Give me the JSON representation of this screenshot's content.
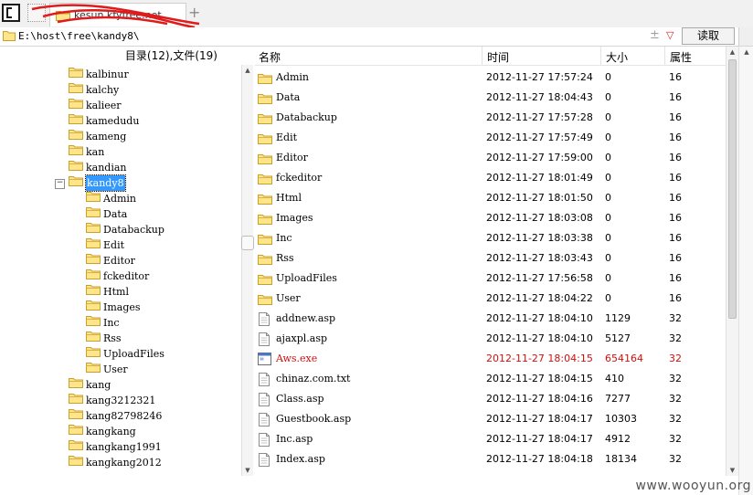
{
  "tab": {
    "title": "kesun.kfyfree.net"
  },
  "address": {
    "path": "E:\\host\\free\\kandy8\\",
    "plus": "±",
    "read_button": "读取"
  },
  "tree": {
    "header": "目录(12),文件(19)",
    "expander": "−",
    "items": [
      {
        "label": "kalbinur"
      },
      {
        "label": "kalchy"
      },
      {
        "label": "kalieer"
      },
      {
        "label": "kamedudu"
      },
      {
        "label": "kameng"
      },
      {
        "label": "kan"
      },
      {
        "label": "kandian"
      },
      {
        "label": "kandy8"
      },
      {
        "label": "Admin"
      },
      {
        "label": "Data"
      },
      {
        "label": "Databackup"
      },
      {
        "label": "Edit"
      },
      {
        "label": "Editor"
      },
      {
        "label": "fckeditor"
      },
      {
        "label": "Html"
      },
      {
        "label": "Images"
      },
      {
        "label": "Inc"
      },
      {
        "label": "Rss"
      },
      {
        "label": "UploadFiles"
      },
      {
        "label": "User"
      },
      {
        "label": "kang"
      },
      {
        "label": "kang3212321"
      },
      {
        "label": "kang82798246"
      },
      {
        "label": "kangkang"
      },
      {
        "label": "kangkang1991"
      },
      {
        "label": "kangkang2012"
      }
    ]
  },
  "list": {
    "columns": {
      "name": "名称",
      "time": "时间",
      "size": "大小",
      "attr": "属性"
    },
    "rows": [
      {
        "name": "Admin",
        "time": "2012-11-27 17:57:24",
        "size": "0",
        "attr": "16",
        "kind": "folder"
      },
      {
        "name": "Data",
        "time": "2012-11-27 18:04:43",
        "size": "0",
        "attr": "16",
        "kind": "folder"
      },
      {
        "name": "Databackup",
        "time": "2012-11-27 17:57:28",
        "size": "0",
        "attr": "16",
        "kind": "folder"
      },
      {
        "name": "Edit",
        "time": "2012-11-27 17:57:49",
        "size": "0",
        "attr": "16",
        "kind": "folder"
      },
      {
        "name": "Editor",
        "time": "2012-11-27 17:59:00",
        "size": "0",
        "attr": "16",
        "kind": "folder"
      },
      {
        "name": "fckeditor",
        "time": "2012-11-27 18:01:49",
        "size": "0",
        "attr": "16",
        "kind": "folder"
      },
      {
        "name": "Html",
        "time": "2012-11-27 18:01:50",
        "size": "0",
        "attr": "16",
        "kind": "folder"
      },
      {
        "name": "Images",
        "time": "2012-11-27 18:03:08",
        "size": "0",
        "attr": "16",
        "kind": "folder"
      },
      {
        "name": "Inc",
        "time": "2012-11-27 18:03:38",
        "size": "0",
        "attr": "16",
        "kind": "folder"
      },
      {
        "name": "Rss",
        "time": "2012-11-27 18:03:43",
        "size": "0",
        "attr": "16",
        "kind": "folder"
      },
      {
        "name": "UploadFiles",
        "time": "2012-11-27 17:56:58",
        "size": "0",
        "attr": "16",
        "kind": "folder"
      },
      {
        "name": "User",
        "time": "2012-11-27 18:04:22",
        "size": "0",
        "attr": "16",
        "kind": "folder"
      },
      {
        "name": "addnew.asp",
        "time": "2012-11-27 18:04:10",
        "size": "1129",
        "attr": "32",
        "kind": "file"
      },
      {
        "name": "ajaxpl.asp",
        "time": "2012-11-27 18:04:10",
        "size": "5127",
        "attr": "32",
        "kind": "file"
      },
      {
        "name": "Aws.exe",
        "time": "2012-11-27 18:04:15",
        "size": "654164",
        "attr": "32",
        "kind": "exe",
        "highlight": "#cc1111"
      },
      {
        "name": "chinaz.com.txt",
        "time": "2012-11-27 18:04:15",
        "size": "410",
        "attr": "32",
        "kind": "file"
      },
      {
        "name": "Class.asp",
        "time": "2012-11-27 18:04:16",
        "size": "7277",
        "attr": "32",
        "kind": "file"
      },
      {
        "name": "Guestbook.asp",
        "time": "2012-11-27 18:04:17",
        "size": "10303",
        "attr": "32",
        "kind": "file"
      },
      {
        "name": "Inc.asp",
        "time": "2012-11-27 18:04:17",
        "size": "4912",
        "attr": "32",
        "kind": "file"
      },
      {
        "name": "Index.asp",
        "time": "2012-11-27 18:04:18",
        "size": "18134",
        "attr": "32",
        "kind": "file"
      }
    ]
  },
  "watermark": "www.wooyun.org"
}
